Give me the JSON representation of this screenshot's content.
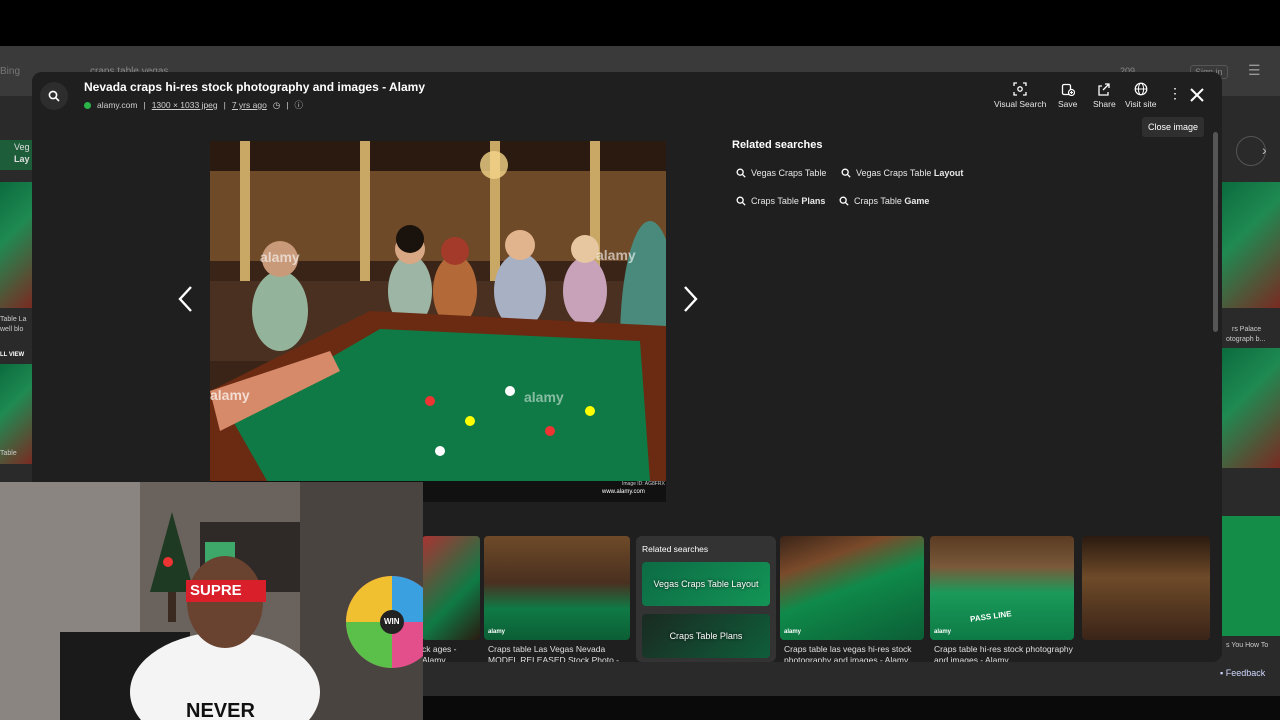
{
  "background": {
    "bing_label": "Bing",
    "search_query": "craps table vegas",
    "count": "209",
    "sign_in": "Sign in",
    "filter_label": "ter",
    "left_text": [
      "Veg",
      "Lay",
      "Table La",
      "well blo",
      "LL VIEW",
      "Table"
    ],
    "right_text": [
      "rs Palace",
      "otograph b...",
      "s You How To"
    ]
  },
  "modal": {
    "title": "Nevada craps hi-res stock photography and images - Alamy",
    "source": "alamy.com",
    "dimensions": "1300 × 1033 jpeg",
    "age": "7 yrs ago",
    "separator": "|",
    "toolbar": {
      "visual_search": "Visual Search",
      "save": "Save",
      "share": "Share",
      "visit_site": "Visit site"
    },
    "close_tooltip": "Close image",
    "image_watermark": "alamy",
    "image_id": "Image ID: AG8FRX",
    "image_url": "www.alamy.com"
  },
  "related": {
    "title": "Related searches",
    "items": [
      {
        "plain": "Vegas Craps Table",
        "bold": ""
      },
      {
        "plain": "Vegas Craps Table ",
        "bold": "Layout"
      },
      {
        "plain": "Craps Table ",
        "bold": "Plans"
      },
      {
        "plain": "Craps Table ",
        "bold": "Game"
      }
    ]
  },
  "strip": {
    "items": [
      {
        "caption": "ck\nages - Alamy",
        "source": ""
      },
      {
        "caption": "Craps table Las Vegas Nevada MODEL RELEASED Stock Photo - ...",
        "source": "alamy"
      },
      {
        "caption": "Craps table las vegas hi-res stock photography and images - Alamy",
        "source": "alamy"
      },
      {
        "caption": "Craps table hi-res stock photography and images - Alamy",
        "source": "alamy"
      }
    ],
    "related_card": {
      "title": "Related searches",
      "items": [
        "Vegas Craps Table Layout",
        "Craps Table Plans"
      ]
    },
    "pass_line": "PASS LINE"
  },
  "webcam": {
    "headband": "SUPRE",
    "shirt": "NEVER",
    "wheel_label": "WIN"
  },
  "feedback": "Feedback"
}
